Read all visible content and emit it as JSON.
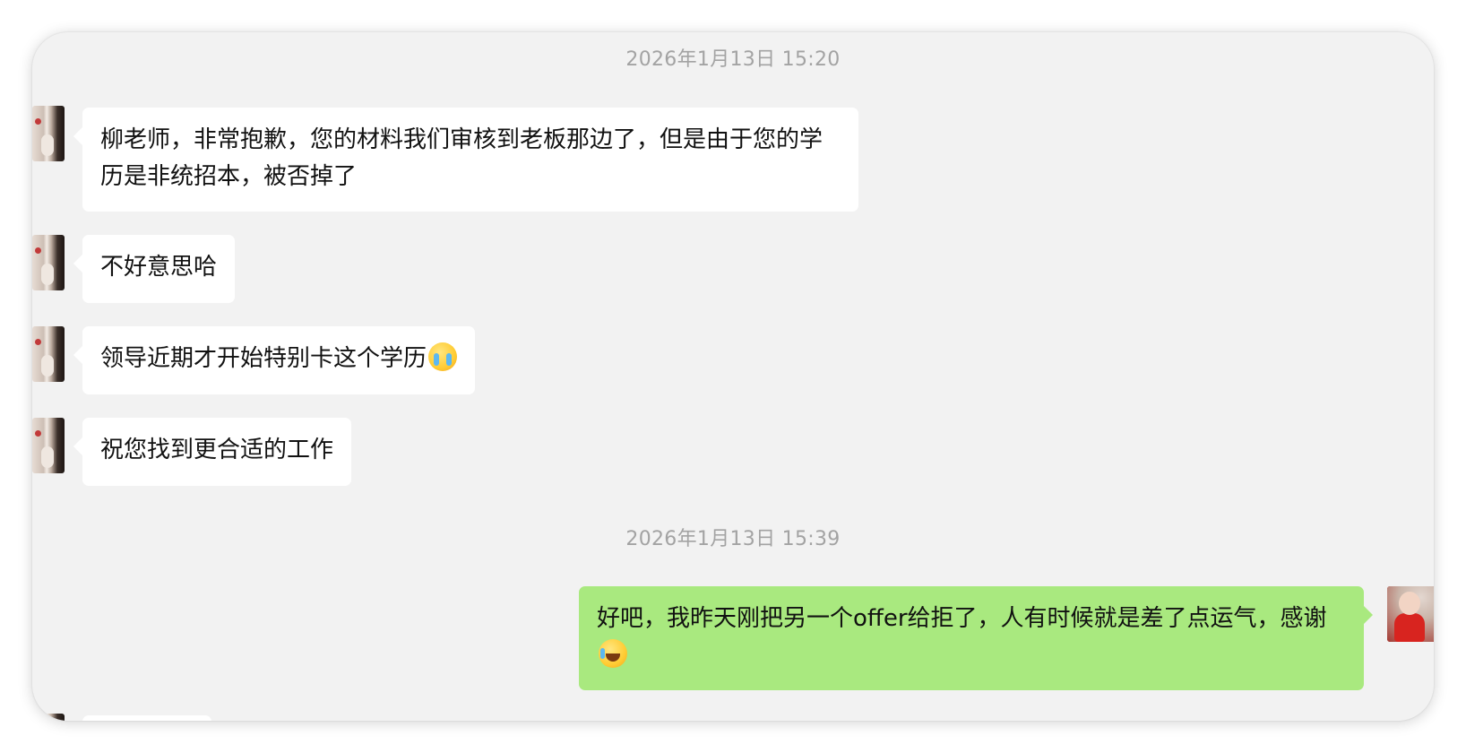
{
  "chat": {
    "timestamps": [
      "2026年1月13日 15:20",
      "2026年1月13日 15:39"
    ],
    "messages": [
      {
        "sender": "other",
        "text": "柳老师，非常抱歉，您的材料我们审核到老板那边了，但是由于您的学历是非统招本，被否掉了"
      },
      {
        "sender": "other",
        "text": "不好意思哈"
      },
      {
        "sender": "other",
        "text": "领导近期才开始特别卡这个学历",
        "emoji": "cry-icon"
      },
      {
        "sender": "other",
        "text": "祝您找到更合适的工作"
      },
      {
        "sender": "me",
        "text": "好吧，我昨天刚把另一个offer给拒了，人有时候就是差了点运气，感谢",
        "emoji": "laugh-icon"
      }
    ]
  },
  "colors": {
    "background": "#f2f2f2",
    "incoming_bubble": "#ffffff",
    "outgoing_bubble": "#a9e97f",
    "timestamp": "#a3a3a3"
  }
}
